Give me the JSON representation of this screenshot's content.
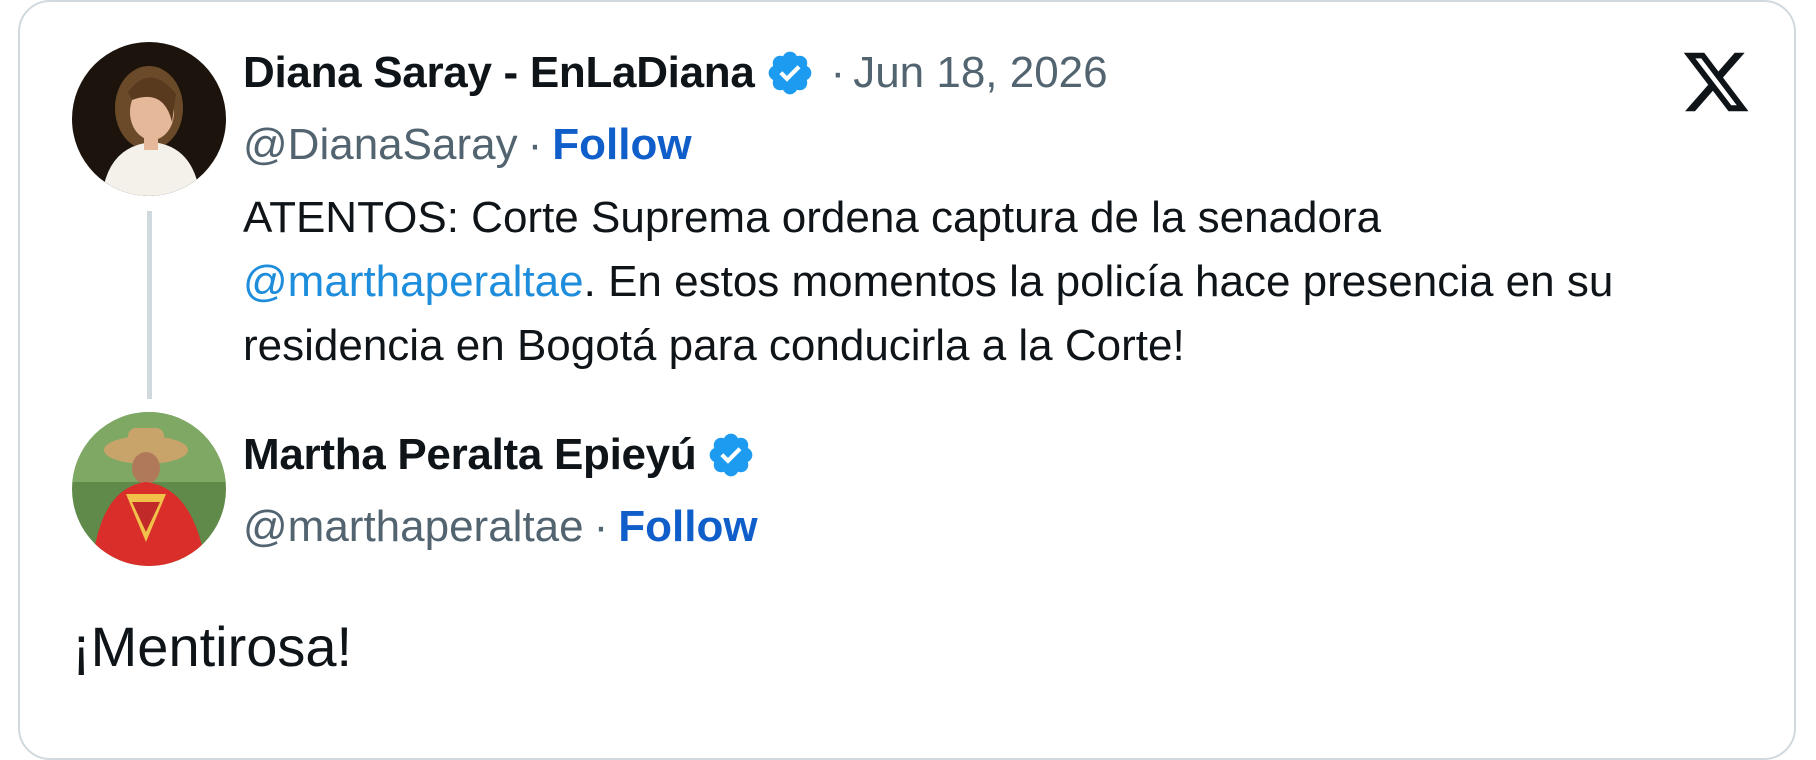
{
  "platform_logo": "x-logo-icon",
  "colors": {
    "verified": "#1d9bf0",
    "mention": "#1d8ddc",
    "follow": "#0f5ec9",
    "secondary_text": "#536471",
    "primary_text": "#0f1419",
    "border": "#cfd9de"
  },
  "quoted_post": {
    "display_name": "Diana Saray - EnLaDiana",
    "verified_icon": "verified-badge-icon",
    "date_separator": "·",
    "date": "Jun 18, 2026",
    "handle": "@DianaSaray",
    "separator": "·",
    "follow_label": "Follow",
    "text_line1": "ATENTOS: Corte Suprema ordena captura de la senadora",
    "mention": "@marthaperaltae",
    "text_line2_rest": ". En estos momentos la policía hace presencia en su",
    "text_line3": "residencia en Bogotá para conducirla a la Corte!"
  },
  "reply_post": {
    "display_name": "Martha Peralta Epieyú",
    "verified_icon": "verified-badge-icon",
    "handle": "@marthaperaltae",
    "separator": "·",
    "follow_label": "Follow",
    "text": "¡Mentirosa!"
  }
}
